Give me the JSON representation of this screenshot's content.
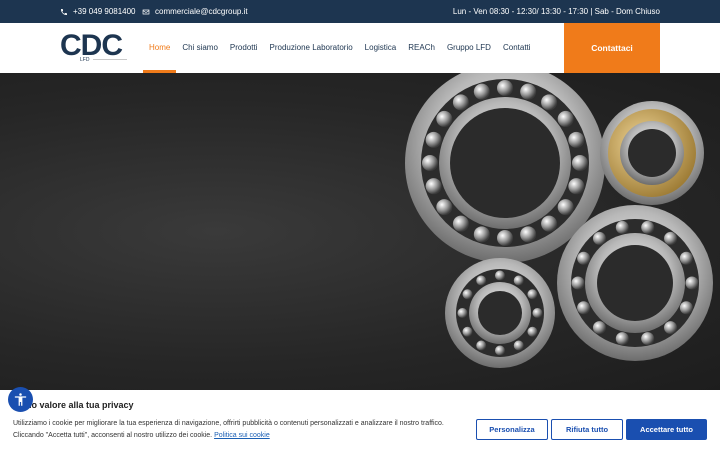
{
  "topbar": {
    "phone": "+39 049 9081400",
    "email": "commerciale@cdcgroup.it",
    "hours": "Lun - Ven 08:30 - 12:30/ 13:30 - 17:30 | Sab - Dom Chiuso",
    "icons": [
      "phone-icon",
      "envelope-icon"
    ]
  },
  "header": {
    "logo_text": "CDC",
    "logo_sub": "LFD",
    "nav": [
      "Home",
      "Chi siamo",
      "Prodotti",
      "Produzione Laboratorio",
      "Logistica",
      "REACh",
      "Gruppo LFD",
      "Contatti"
    ],
    "active_nav": "Home",
    "cta_label": "Contattaci"
  },
  "cookie": {
    "title": "no valore alla tua privacy",
    "description": "Utilizziamo i cookie per migliorare la tua esperienza di navigazione, offrirti pubblicità o contenuti personalizzati e analizzare il nostro traffico. Cliccando \"Accetta tutti\", acconsenti al nostro utilizzo dei cookie.",
    "policy_link": "Politica sui cookie",
    "buttons": {
      "personalizza": "Personalizza",
      "rifiuta": "Rifiuta tutto",
      "accetta": "Accettare tutto"
    }
  },
  "colors": {
    "navy": "#1d3550",
    "orange": "#f07b1a",
    "blue": "#1a4fb0"
  }
}
